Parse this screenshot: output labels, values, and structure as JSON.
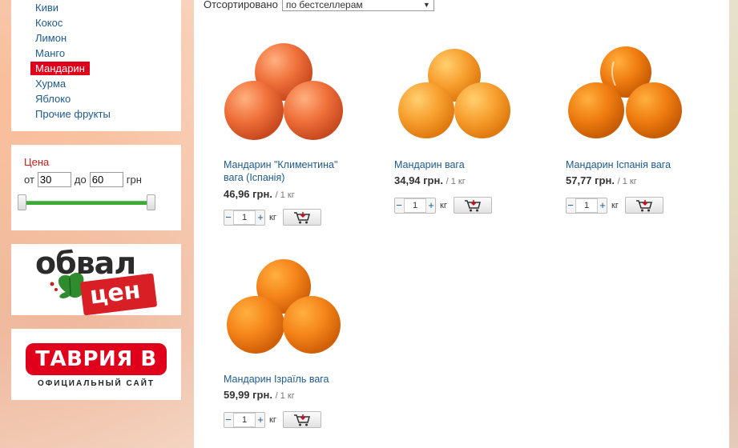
{
  "sidebar": {
    "categories": [
      {
        "label": "Киви"
      },
      {
        "label": "Кокос"
      },
      {
        "label": "Лимон"
      },
      {
        "label": "Манго"
      },
      {
        "label": "Мандарин",
        "active": true
      },
      {
        "label": "Хурма"
      },
      {
        "label": "Яблоко"
      },
      {
        "label": "Прочие фрукты"
      }
    ],
    "price_filter": {
      "title": "Цена",
      "from_label": "от",
      "from_value": "30",
      "to_label": "до",
      "to_value": "60",
      "currency": "грн"
    },
    "banners": {
      "obval_top": "обвал",
      "obval_bottom": "цен",
      "tavria_logo": "ТАВРИЯ В",
      "tavria_sub": "ОФИЦИАЛЬНЫЙ САЙТ"
    }
  },
  "main": {
    "sort_label": "Отсортировано",
    "sort_value": "по бестселлерам",
    "products": [
      {
        "name": "Мандарин \"Климентина\" вага (Іспанія)",
        "price": "46,96 грн.",
        "unit": "/ 1 кг",
        "qty": "1",
        "qty_unit": "кг"
      },
      {
        "name": "Мандарин вага",
        "price": "34,94 грн.",
        "unit": "/ 1 кг",
        "qty": "1",
        "qty_unit": "кг"
      },
      {
        "name": "Мандарин Іспанія вага",
        "price": "57,77 грн.",
        "unit": "/ 1 кг",
        "qty": "1",
        "qty_unit": "кг"
      },
      {
        "name": "Мандарин Ізраїль вага",
        "price": "59,99 грн.",
        "unit": "/ 1 кг",
        "qty": "1",
        "qty_unit": "кг"
      }
    ]
  },
  "colors": {
    "accent_red": "#e0001b",
    "link_blue": "#1f5a8a",
    "slider_green": "#3bab35",
    "orange": "#f5901e"
  }
}
